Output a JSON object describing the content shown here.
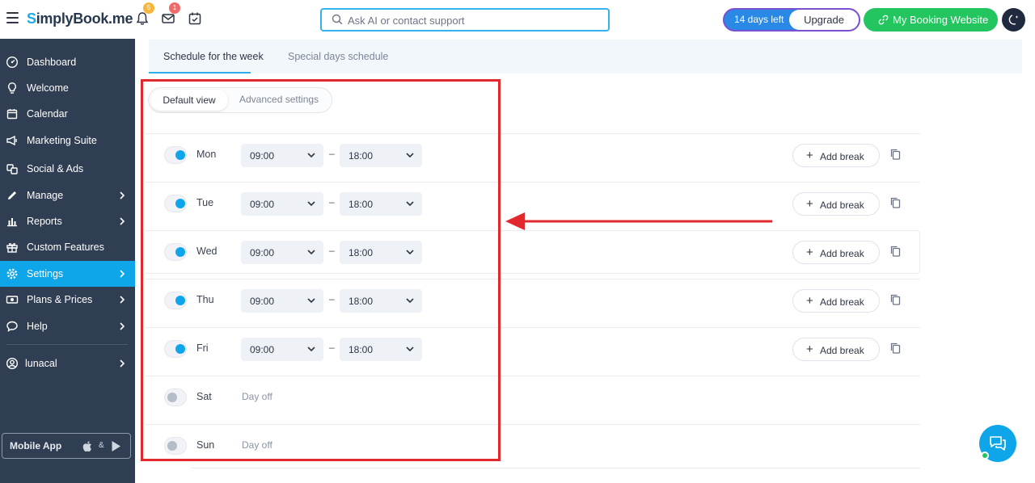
{
  "header": {
    "logo": {
      "s": "S",
      "rest": "implyBook",
      "suffix": ".me"
    },
    "notifications_badge": "5",
    "mail_badge": "1",
    "search_placeholder": "Ask AI or contact support",
    "trial_text": "14 days left",
    "upgrade_label": "Upgrade",
    "booking_label": "My Booking Website",
    "icons": {
      "menu": "hamburger-icon",
      "bell": "bell-icon",
      "mail": "mail-icon",
      "calendar": "calendar-check-icon",
      "search": "search-icon",
      "link": "link-icon",
      "theme": "moon-icon"
    },
    "colors": {
      "accent": "#0fa5e9",
      "trial": "#2a89e4",
      "booking": "#22c55e",
      "highlight": "#e0282d"
    }
  },
  "sidebar": {
    "items": [
      {
        "label": "Dashboard",
        "icon": "dashboard-gauge-icon",
        "chevron": false,
        "active": false
      },
      {
        "label": "Welcome",
        "icon": "lightbulb-icon",
        "chevron": false,
        "active": false
      },
      {
        "label": "Calendar",
        "icon": "calendar-icon",
        "chevron": false,
        "active": false
      },
      {
        "label": "Marketing Suite",
        "icon": "megaphone-icon",
        "chevron": false,
        "active": false
      },
      {
        "label": "Social & Ads",
        "icon": "social-icon",
        "chevron": false,
        "active": false
      },
      {
        "label": "Manage",
        "icon": "pencil-icon",
        "chevron": true,
        "active": false
      },
      {
        "label": "Reports",
        "icon": "bar-chart-icon",
        "chevron": true,
        "active": false
      },
      {
        "label": "Custom Features",
        "icon": "gift-icon",
        "chevron": false,
        "active": false
      },
      {
        "label": "Settings",
        "icon": "gear-icon",
        "chevron": true,
        "active": true
      },
      {
        "label": "Plans & Prices",
        "icon": "money-icon",
        "chevron": true,
        "active": false
      },
      {
        "label": "Help",
        "icon": "chat-bubble-icon",
        "chevron": true,
        "active": false
      }
    ],
    "user": {
      "label": "lunacal",
      "icon": "user-circle-icon"
    },
    "mobile_app": {
      "label": "Mobile App",
      "amp": "&",
      "icons": [
        "apple-icon",
        "play-store-icon"
      ]
    }
  },
  "tabs": [
    {
      "label": "Schedule for the week",
      "active": true
    },
    {
      "label": "Special days schedule",
      "active": false
    }
  ],
  "view_toggle": {
    "default": "Default view",
    "advanced": "Advanced settings"
  },
  "schedule": {
    "add_break_label": "Add break",
    "dash": "–",
    "day_off_label": "Day off",
    "days": [
      {
        "name": "Mon",
        "enabled": true,
        "start": "09:00",
        "end": "18:00"
      },
      {
        "name": "Tue",
        "enabled": true,
        "start": "09:00",
        "end": "18:00"
      },
      {
        "name": "Wed",
        "enabled": true,
        "start": "09:00",
        "end": "18:00"
      },
      {
        "name": "Thu",
        "enabled": true,
        "start": "09:00",
        "end": "18:00"
      },
      {
        "name": "Fri",
        "enabled": true,
        "start": "09:00",
        "end": "18:00"
      },
      {
        "name": "Sat",
        "enabled": false,
        "start": "",
        "end": ""
      },
      {
        "name": "Sun",
        "enabled": false,
        "start": "",
        "end": ""
      }
    ]
  },
  "chat_widget": {
    "icon": "chat-support-icon"
  }
}
